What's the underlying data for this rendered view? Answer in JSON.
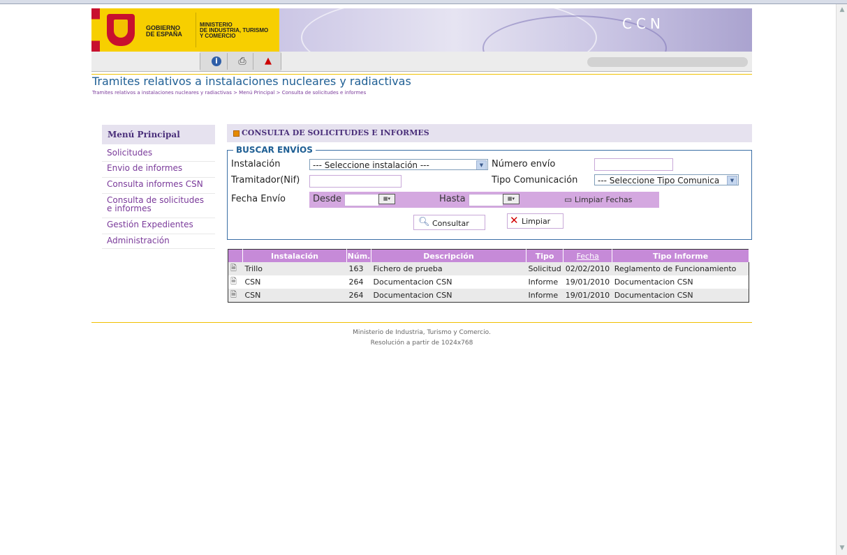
{
  "header": {
    "gov_line1": "GOBIERNO",
    "gov_line2": "DE ESPAÑA",
    "min_line1": "MINISTERIO",
    "min_line2": "DE INDUSTRIA, TURISMO",
    "min_line3": "Y COMERCIO",
    "brand": "CCN"
  },
  "toolbar": {
    "icons": [
      "info-icon",
      "print-icon",
      "warning-icon"
    ]
  },
  "page": {
    "title": "Tramites relativos a instalaciones nucleares y radiactivas",
    "breadcrumb": "Tramites relativos a instalaciones nucleares y radiactivas > Menú Principal > Consulta de solicitudes e informes"
  },
  "sidebar": {
    "title": "Menú Principal",
    "items": [
      {
        "label": "Solicitudes"
      },
      {
        "label": "Envio de informes"
      },
      {
        "label": "Consulta informes CSN"
      },
      {
        "label": "Consulta de solicitudes e informes"
      },
      {
        "label": "Gestión Expedientes"
      },
      {
        "label": "Administración"
      }
    ]
  },
  "section": {
    "title": "CONSULTA DE SOLICITUDES E INFORMES"
  },
  "search": {
    "legend": "BUSCAR ENVÍOS",
    "instalacion_label": "Instalación",
    "instalacion_value": "--- Seleccione instalación ---",
    "numero_label": "Número envío",
    "numero_value": "",
    "tramitador_label": "Tramitador(Nif)",
    "tramitador_value": "",
    "tipo_label": "Tipo Comunicación",
    "tipo_value": "--- Seleccione Tipo Comunica",
    "fecha_label": "Fecha Envío",
    "desde_label": "Desde",
    "hasta_label": "Hasta",
    "limpiar_fechas": "Limpiar Fechas",
    "consultar": "Consultar",
    "limpiar": "Limpiar"
  },
  "results": {
    "columns": [
      "Instalación",
      "Núm.",
      "Descripción",
      "Tipo",
      "Fecha",
      "Tipo Informe"
    ],
    "rows": [
      {
        "instalacion": "Trillo",
        "num": "163",
        "descripcion": "Fichero de prueba",
        "tipo": "Solicitud",
        "fecha": "02/02/2010",
        "tipo_informe": "Reglamento de Funcionamiento"
      },
      {
        "instalacion": "CSN",
        "num": "264",
        "descripcion": "Documentacion CSN",
        "tipo": "Informe",
        "fecha": "19/01/2010",
        "tipo_informe": "Documentacion CSN"
      },
      {
        "instalacion": "CSN",
        "num": "264",
        "descripcion": "Documentacion CSN",
        "tipo": "Informe",
        "fecha": "19/01/2010",
        "tipo_informe": "Documentacion CSN"
      }
    ]
  },
  "footer": {
    "line1": "Ministerio de Industria, Turismo y Comercio.",
    "line2": "Resolución a partir de 1024x768"
  },
  "colors": {
    "accent_blue": "#1f5f94",
    "menu_purple": "#7a3a9a",
    "header_band": "#c68ad8",
    "gov_yellow": "#f7cf00"
  }
}
